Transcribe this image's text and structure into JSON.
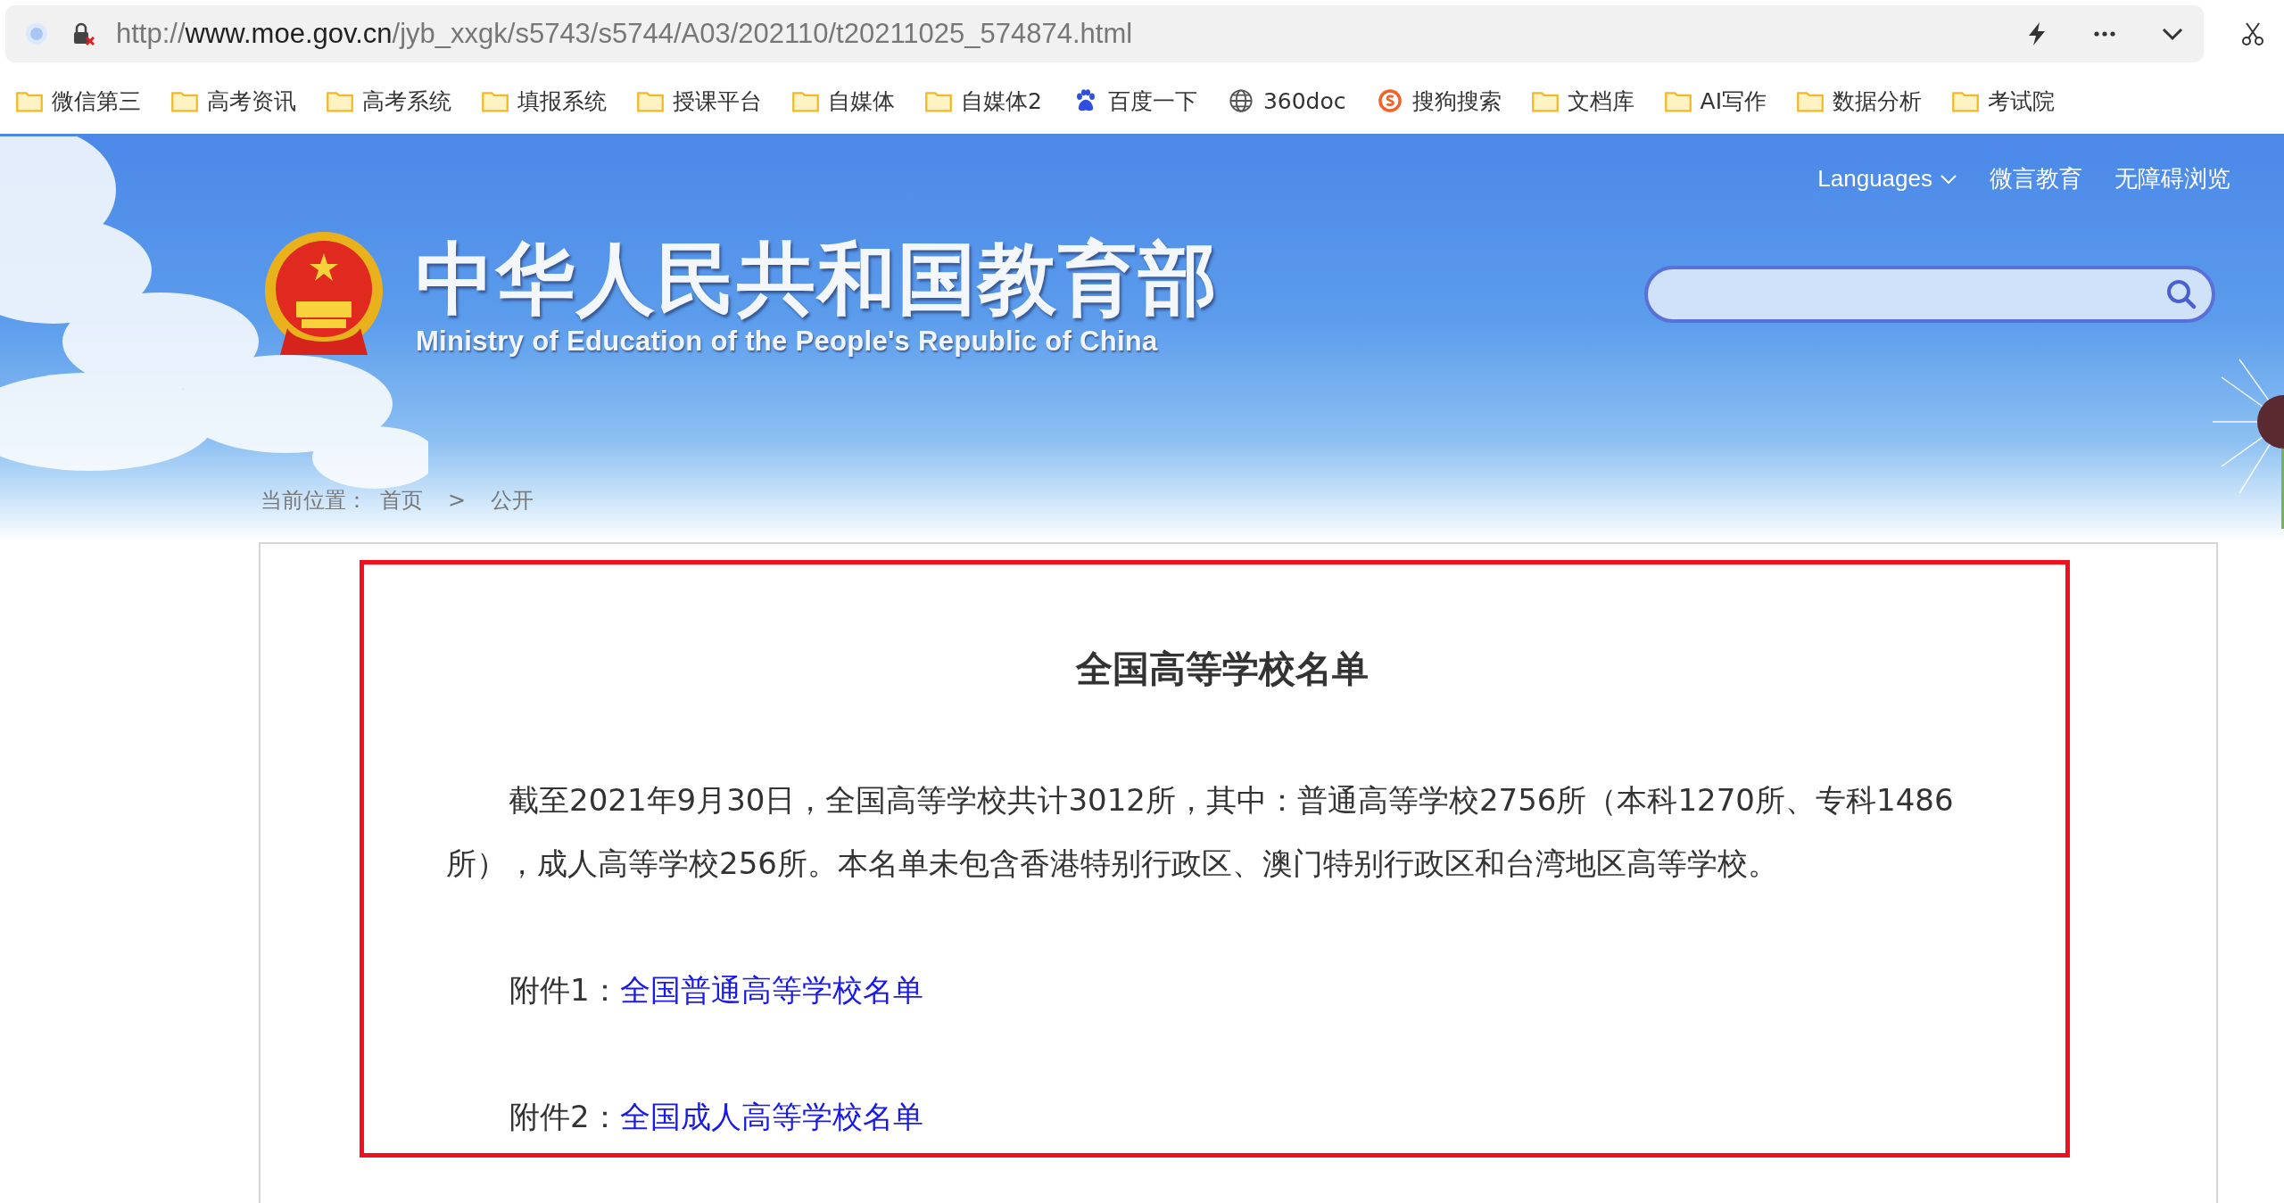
{
  "browser": {
    "url": "http://**www.moe.gov.cn**/jyb_xxgk/s5743/s5744/A03/202110/t20211025_574874.html"
  },
  "bookmarks": [
    {
      "kind": "folder",
      "label": "微信第三"
    },
    {
      "kind": "folder",
      "label": "高考资讯"
    },
    {
      "kind": "folder",
      "label": "高考系统"
    },
    {
      "kind": "folder",
      "label": "填报系统"
    },
    {
      "kind": "folder",
      "label": "授课平台"
    },
    {
      "kind": "folder",
      "label": "自媒体"
    },
    {
      "kind": "folder",
      "label": "自媒体2"
    },
    {
      "kind": "paw",
      "label": "百度一下"
    },
    {
      "kind": "globe",
      "label": "360doc"
    },
    {
      "kind": "sogou",
      "label": "搜狗搜索"
    },
    {
      "kind": "folder",
      "label": "文档库"
    },
    {
      "kind": "folder",
      "label": "AI写作"
    },
    {
      "kind": "folder",
      "label": "数据分析"
    },
    {
      "kind": "folder",
      "label": "考试院"
    }
  ],
  "header": {
    "top_links": [
      {
        "label": "Languages",
        "dropdown": true
      },
      {
        "label": "微言教育",
        "dropdown": false
      },
      {
        "label": "无障碍浏览",
        "dropdown": false
      }
    ],
    "site_title": "中华人民共和国教育部",
    "site_subtitle": "Ministry of Education of the People's Republic of China"
  },
  "breadcrumb": {
    "label": "当前位置：",
    "items": [
      "首页",
      "公开"
    ],
    "separator": ">"
  },
  "article": {
    "title": "全国高等学校名单",
    "paragraph": "截至2021年9月30日，全国高等学校共计3012所，其中：普通高等学校2756所（本科1270所、专科1486所），成人高等学校256所。本名单未包含香港特别行政区、澳门特别行政区和台湾地区高等学校。",
    "attachments": [
      {
        "label": "附件1：",
        "link": "全国普通高等学校名单"
      },
      {
        "label": "附件2：",
        "link": "全国成人高等学校名单"
      }
    ]
  }
}
